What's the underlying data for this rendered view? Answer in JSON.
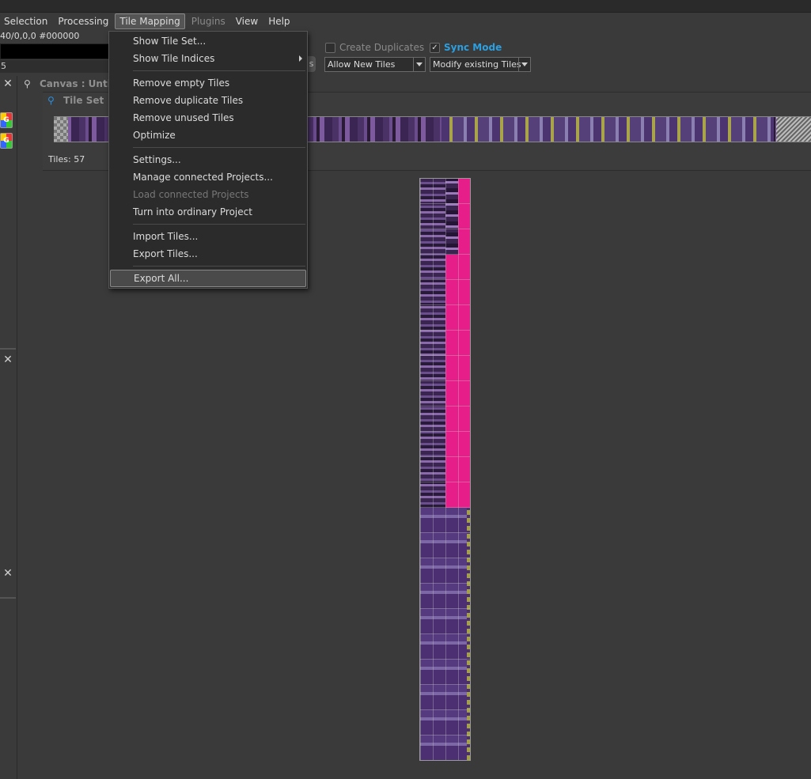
{
  "menubar": {
    "items": [
      {
        "label": "Selection",
        "state": "normal"
      },
      {
        "label": "Processing",
        "state": "normal"
      },
      {
        "label": "Tile Mapping",
        "state": "active"
      },
      {
        "label": "Plugins",
        "state": "disabled"
      },
      {
        "label": "View",
        "state": "normal"
      },
      {
        "label": "Help",
        "state": "normal"
      }
    ]
  },
  "status": {
    "coords": "40/0,0,0 #000000",
    "number": "5"
  },
  "tool_options": {
    "create_duplicates_label": "Create Duplicates",
    "create_duplicates_checked": false,
    "sync_mode_label": "Sync Mode",
    "sync_mode_checked": true,
    "new_tiles_combo": "Allow New Tiles",
    "modify_combo": "Modify existing Tiles",
    "stub_text": "s"
  },
  "canvas": {
    "title": "Canvas : Untitl"
  },
  "tileset": {
    "title": "Tile Set",
    "count_label": "Tiles:  57"
  },
  "tile_mapping_menu": {
    "items": [
      {
        "label": "Show Tile Set...",
        "disabled": false,
        "submenu": false,
        "highlighted": false
      },
      {
        "label": "Show Tile Indices",
        "disabled": false,
        "submenu": true,
        "highlighted": false
      },
      {
        "separator": true
      },
      {
        "label": "Remove empty Tiles",
        "disabled": false,
        "submenu": false,
        "highlighted": false
      },
      {
        "label": "Remove duplicate Tiles",
        "disabled": false,
        "submenu": false,
        "highlighted": false
      },
      {
        "label": "Remove unused Tiles",
        "disabled": false,
        "submenu": false,
        "highlighted": false
      },
      {
        "label": "Optimize",
        "disabled": false,
        "submenu": false,
        "highlighted": false
      },
      {
        "separator": true
      },
      {
        "label": "Settings...",
        "disabled": false,
        "submenu": false,
        "highlighted": false
      },
      {
        "label": "Manage connected Projects...",
        "disabled": false,
        "submenu": false,
        "highlighted": false
      },
      {
        "label": "Load connected Projects",
        "disabled": true,
        "submenu": false,
        "highlighted": false
      },
      {
        "label": "Turn into ordinary Project",
        "disabled": false,
        "submenu": false,
        "highlighted": false
      },
      {
        "separator": true
      },
      {
        "label": "Import Tiles...",
        "disabled": false,
        "submenu": false,
        "highlighted": false
      },
      {
        "label": "Export Tiles...",
        "disabled": false,
        "submenu": false,
        "highlighted": false
      },
      {
        "separator": true
      },
      {
        "label": "Export All...",
        "disabled": false,
        "submenu": false,
        "highlighted": true
      }
    ]
  },
  "colors": {
    "accent": "#2b9fe0",
    "tile_pink": "#e61e8a",
    "tile_purple": "#4b2f72",
    "tile_olive": "#a4a046"
  }
}
